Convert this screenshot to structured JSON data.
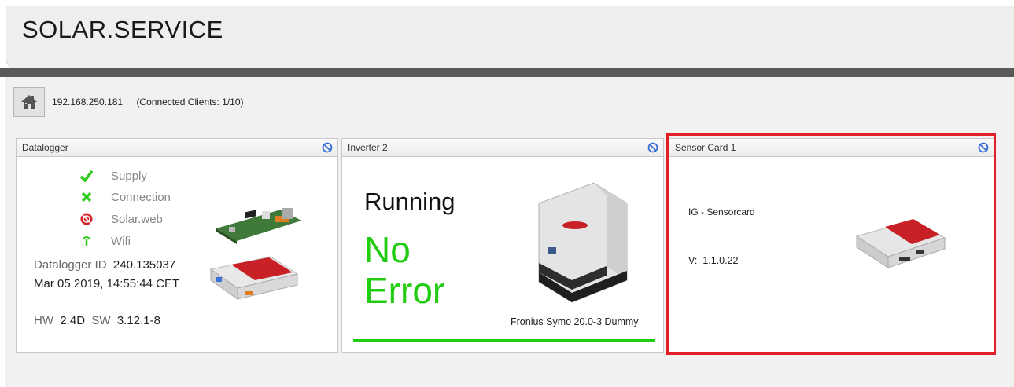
{
  "app": {
    "title": "SOLAR.SERVICE"
  },
  "connection": {
    "ip": "192.168.250.181",
    "clients": "(Connected Clients: 1/10)"
  },
  "datalogger": {
    "title": "Datalogger",
    "status": [
      {
        "icon": "check-icon",
        "label": "Supply",
        "color": "#2ecc1a"
      },
      {
        "icon": "cross-icon",
        "label": "Connection",
        "color": "#2ecc1a"
      },
      {
        "icon": "solarweb-icon",
        "label": "Solar.web",
        "color": "#d9262a"
      },
      {
        "icon": "wifi-antenna-icon",
        "label": "Wifi",
        "color": "#2ecc1a"
      }
    ],
    "id_label": "Datalogger ID",
    "id_value": "240.135037",
    "datetime": "Mar 05 2019, 14:55:44 CET",
    "hw_label": "HW",
    "hw_value": "2.4D",
    "sw_label": "SW",
    "sw_value": "3.12.1-8"
  },
  "inverter": {
    "title": "Inverter 2",
    "state": "Running",
    "error_line1": "No",
    "error_line2": "Error",
    "model": "Fronius Symo 20.0-3 Dummy",
    "ok_color": "#22cc11"
  },
  "sensor": {
    "title": "Sensor Card 1",
    "name": "IG - Sensorcard",
    "version_label": "V:",
    "version_value": "1.1.0.22",
    "highlight_color": "#e02028"
  }
}
